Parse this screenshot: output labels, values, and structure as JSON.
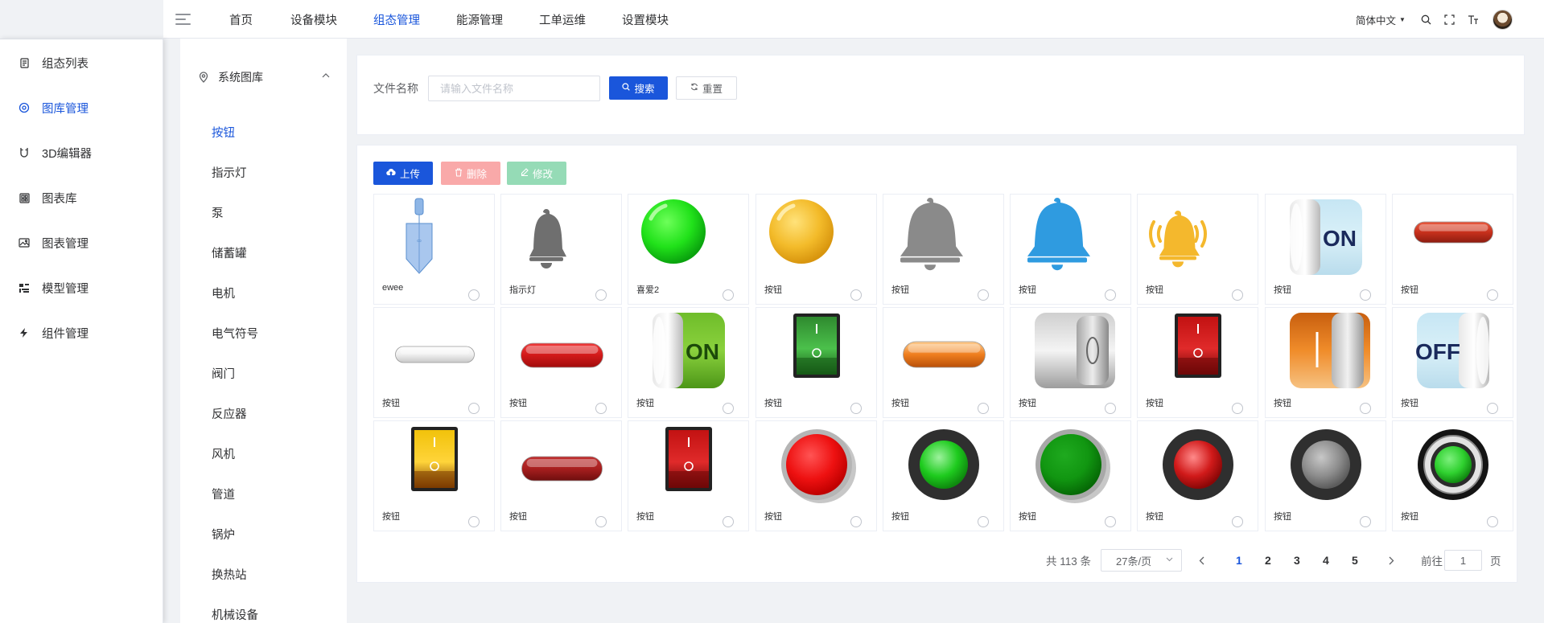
{
  "sidebar": {
    "items": [
      {
        "label": "组态列表",
        "icon": "document-icon"
      },
      {
        "label": "图库管理",
        "icon": "gallery-icon",
        "active": true
      },
      {
        "label": "3D编辑器",
        "icon": "magnet-icon"
      },
      {
        "label": "图表库",
        "icon": "grid-icon"
      },
      {
        "label": "图表管理",
        "icon": "image-icon"
      },
      {
        "label": "模型管理",
        "icon": "model-icon"
      },
      {
        "label": "组件管理",
        "icon": "component-icon"
      }
    ]
  },
  "topnav": {
    "items": [
      "首页",
      "设备模块",
      "组态管理",
      "能源管理",
      "工单运维",
      "设置模块"
    ],
    "active": "组态管理",
    "language": "简体中文"
  },
  "category": {
    "header": "系统图库",
    "items": [
      "按钮",
      "指示灯",
      "泵",
      "储蓄罐",
      "电机",
      "电气符号",
      "阀门",
      "反应器",
      "风机",
      "管道",
      "锅炉",
      "换热站",
      "机械设备"
    ],
    "active": "按钮"
  },
  "search": {
    "label": "文件名称",
    "placeholder": "请输入文件名称",
    "search_label": "搜索",
    "reset_label": "重置"
  },
  "toolbar": {
    "upload_label": "上传",
    "delete_label": "删除",
    "edit_label": "修改"
  },
  "gallery": [
    {
      "label": "ewee",
      "art": "beaker"
    },
    {
      "label": "指示灯",
      "art": "bell-gray-small"
    },
    {
      "label": "喜爱2",
      "art": "ball-green"
    },
    {
      "label": "按钮",
      "art": "ball-yellow"
    },
    {
      "label": "按钮",
      "art": "bell-gray"
    },
    {
      "label": "按钮",
      "art": "bell-blue"
    },
    {
      "label": "按钮",
      "art": "bell-alarm"
    },
    {
      "label": "按钮",
      "art": "toggle-on-blue"
    },
    {
      "label": "按钮",
      "art": "pill-red"
    },
    {
      "label": "按钮",
      "art": "pill-white"
    },
    {
      "label": "按钮",
      "art": "bar-red"
    },
    {
      "label": "按钮",
      "art": "toggle-on-green"
    },
    {
      "label": "按钮",
      "art": "rocker-green"
    },
    {
      "label": "按钮",
      "art": "pill-orange"
    },
    {
      "label": "按钮",
      "art": "toggle-silver"
    },
    {
      "label": "按钮",
      "art": "rocker-red"
    },
    {
      "label": "按钮",
      "art": "toggle-orange"
    },
    {
      "label": "按钮",
      "art": "toggle-off-blue"
    },
    {
      "label": "按钮",
      "art": "rocker-yellow"
    },
    {
      "label": "按钮",
      "art": "pill-darkred"
    },
    {
      "label": "按钮",
      "art": "rocker-red2"
    },
    {
      "label": "按钮",
      "art": "push-red"
    },
    {
      "label": "按钮",
      "art": "push-green-black"
    },
    {
      "label": "按钮",
      "art": "push-green"
    },
    {
      "label": "按钮",
      "art": "push-red-black"
    },
    {
      "label": "按钮",
      "art": "push-gray"
    },
    {
      "label": "按钮",
      "art": "push-green-ring"
    }
  ],
  "pagination": {
    "total_text": "共 113 条",
    "page_size": "27条/页",
    "pages": [
      "1",
      "2",
      "3",
      "4",
      "5"
    ],
    "current": "1",
    "goto_label": "前往",
    "goto_value": "1",
    "page_suffix": "页"
  },
  "colors": {
    "primary": "#1a56db",
    "danger_light": "#f9a9a9",
    "success_light": "#95dbb6"
  }
}
